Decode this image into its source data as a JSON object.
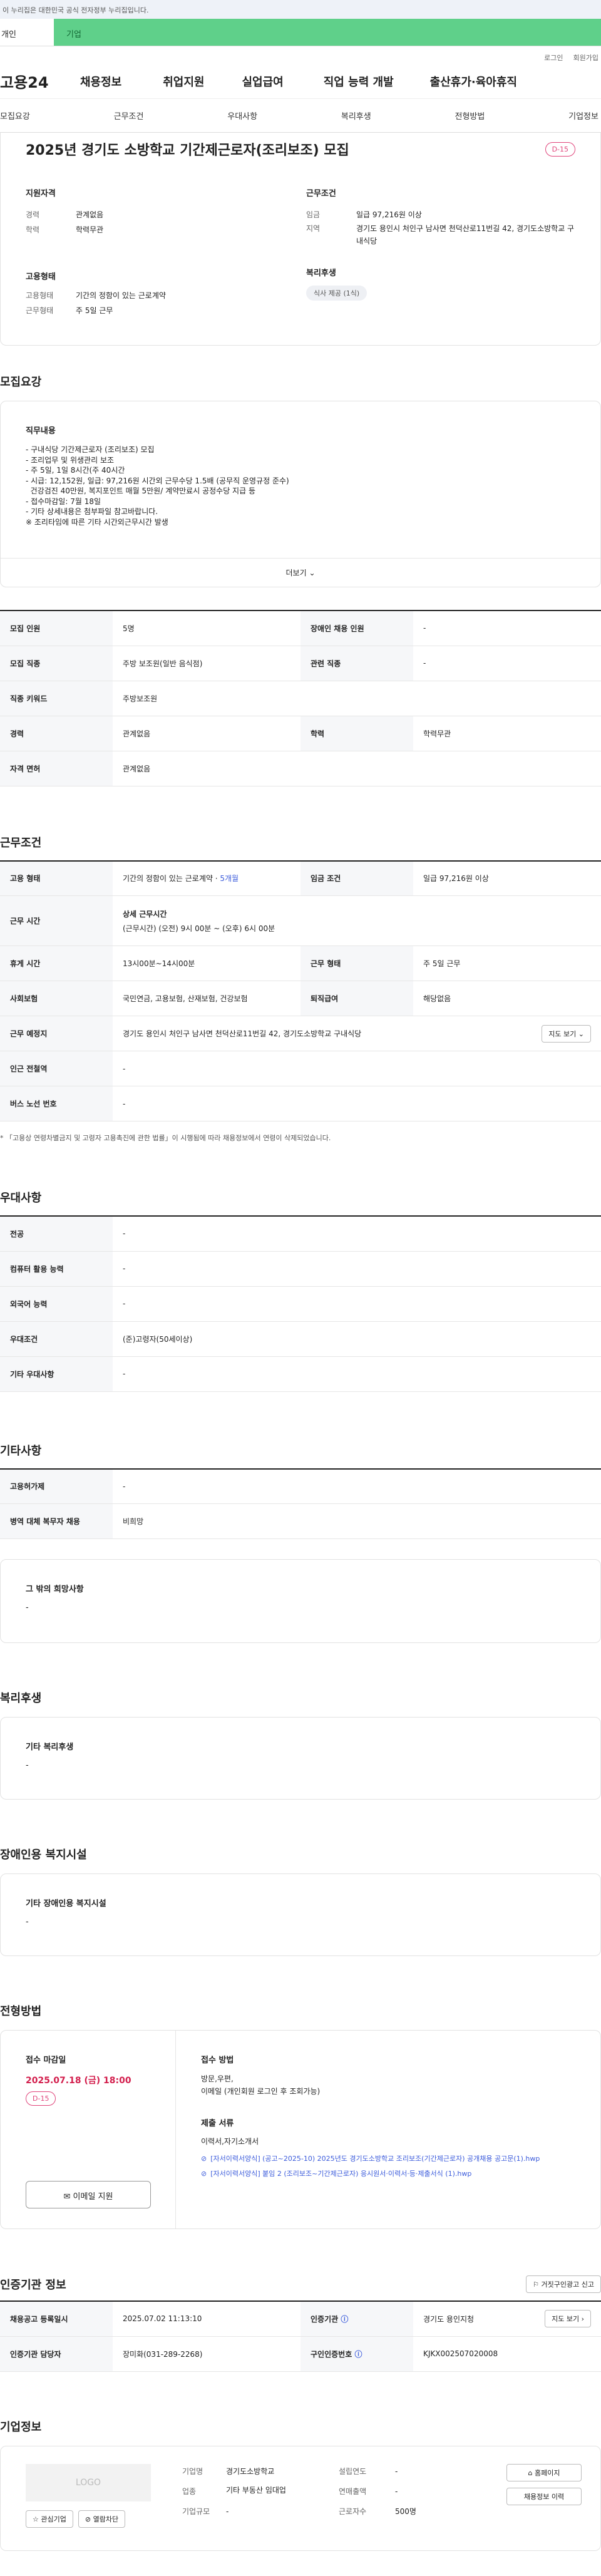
{
  "gov_notice": "이 누리집은 대한민국 공식 전자정부 누리집입니다.",
  "tabs": [
    "개인",
    "기업"
  ],
  "top_links": [
    "로그인",
    "회원가입"
  ],
  "gnb": {
    "logo": "고용24",
    "menu": [
      "채용정보",
      "취업지원",
      "실업급여",
      "직업 능력 개발",
      "출산휴가·육아휴직"
    ]
  },
  "subnav": [
    "모집요강",
    "근무조건",
    "우대사항",
    "복리후생",
    "전형방법",
    "기업정보"
  ],
  "header": {
    "title": "2025년 경기도 소방학교 기간제근로자(조리보조) 모집",
    "dday": "D-15",
    "qual_label": "지원자격",
    "career_k": "경력",
    "career_v": "관계없음",
    "edu_k": "학력",
    "edu_v": "학력무관",
    "cond_label": "근무조건",
    "wage_k": "임금",
    "wage_v": "일급 97,216원 이상",
    "region_k": "지역",
    "region_v": "경기도 용인시 처인구 남사면 천덕산로11번길 42, 경기도소방학교 구내식당",
    "emp_label": "고용형태",
    "etype_k": "고용형태",
    "etype_v": "기간의 정함이 있는 근로계약",
    "eform_k": "근무형태",
    "eform_v": "주 5일 근무",
    "welfare_label": "복리후생",
    "welfare_pill": "식사 제공 (1식)"
  },
  "recruit": {
    "title": "모집요강",
    "duty_label": "직무내용",
    "lines": [
      "- 구내식당 기간제근로자 (조리보조) 모집",
      "- 조리업무 및 위생관리 보조",
      "- 주 5일, 1일 8시간(주 40시간",
      "- 시급: 12,152원, 일급: 97,216원 시간외 근무수당 1.5배 (공무직 운영규정 준수)",
      "  건강검진 40만원, 복지포인트 매월 5만원/ 계약만료시 공정수당 지급 등",
      "- 접수마감일: 7월 18일",
      "- 기타 상세내용은 첨부파일 참고바랍니다.",
      "※ 조리타임에 따른 기타 시간외근무시간 발생"
    ],
    "more": "더보기",
    "rows": [
      [
        "모집 인원",
        "5명",
        "장애인 채용 인원",
        "-"
      ],
      [
        "모집 직종",
        "주방 보조원(일반 음식점)",
        "관련 직종",
        "-"
      ],
      [
        "직종 키워드",
        "주방보조원"
      ],
      [
        "경력",
        "관계없음",
        "학력",
        "학력무관"
      ],
      [
        "자격 면허",
        "관계없음"
      ]
    ]
  },
  "work": {
    "title": "근무조건",
    "etype_k": "고용 형태",
    "etype_v": "기간의 정함이 있는 근로계약 · ",
    "months": "5개월",
    "wage_k": "임금 조건",
    "wage_v": "일급 97,216원 이상",
    "hours_k": "근무 시간",
    "hours_t": "상세 근무시간",
    "hours_v": "(근무시간) (오전) 9시 00분 ~ (오후) 6시 00분",
    "rest_k": "휴게 시간",
    "rest_v": "13시00분~14시00분",
    "form_k": "근무 형태",
    "form_v": "주 5일 근무",
    "ins_k": "사회보험",
    "ins_v": "국민연금, 고용보험, 산재보험, 건강보험",
    "ret_k": "퇴직급여",
    "ret_v": "해당없음",
    "place_k": "근무 예정지",
    "place_v": "경기도 용인시 처인구 남사면 천덕산로11번길 42, 경기도소방학교 구내식당",
    "map": "지도 보기",
    "sub_k": "인근 전철역",
    "sub_v": "-",
    "bus_k": "버스 노선 번호",
    "bus_v": "-",
    "note": "* 「고용상 연령차별금지 및 고령자 고용촉진에 관한 법률」이 시행됨에 따라 채용정보에서 연령이 삭제되었습니다."
  },
  "pref": {
    "title": "우대사항",
    "rows": [
      [
        "전공",
        "-"
      ],
      [
        "컴퓨터 활용 능력",
        "-"
      ],
      [
        "외국어 능력",
        "-"
      ],
      [
        "우대조건",
        "(준)고령자(50세이상)"
      ],
      [
        "기타 우대사항",
        "-"
      ]
    ]
  },
  "etc": {
    "title": "기타사항",
    "rows": [
      [
        "고용허가제",
        "-"
      ],
      [
        "병역 대체 복무자 채용",
        "비희망"
      ]
    ],
    "other_label": "그 밖의 희망사항",
    "other_v": "-"
  },
  "welfare": {
    "title": "복리후생",
    "label": "기타 복리후생",
    "v": "-"
  },
  "disab": {
    "title": "장애인용 복지시설",
    "label": "기타 장애인용 복지시설",
    "v": "-"
  },
  "proc": {
    "title": "전형방법",
    "deadline_label": "접수 마감일",
    "deadline": "2025.07.18 (금) 18:00",
    "dday": "D-15",
    "apply": "이메일 지원",
    "method_label": "접수 방법",
    "method_v": "방문,우편,",
    "method_v2": "이메일 (개인회원 로그인 후 조회가능)",
    "docs_label": "제출 서류",
    "docs_v": "이력서,자기소개서",
    "file1": "[자서이력서양식] (공고~2025-10) 2025년도 경기도소방학교 조리보조(기간제근로자) 공개채용 공고문(1).hwp",
    "file2": "[자서이력서양식] 붙임 2 (조리보조~기간제근로자) 응시원서·이력서·등·제출서식 (1).hwp"
  },
  "agency": {
    "title": "인증기관 정보",
    "report": "거짓구인광고 신고",
    "reg_k": "채용공고 등록일시",
    "reg_v": "2025.07.02 11:13:10",
    "org_k": "인증기관",
    "org_v": "경기도 용인지청",
    "map": "지도 보기",
    "mgr_k": "인증기관 담당자",
    "mgr_v": "장미화(031-289-2268)",
    "no_k": "구인인증번호",
    "no_v": "KJKX002507020008"
  },
  "company": {
    "title": "기업정보",
    "logo": "LOGO",
    "fav": "관심기업",
    "block": "열람차단",
    "name_k": "기업명",
    "name_v": "경기도소방학교",
    "year_k": "설립연도",
    "year_v": "-",
    "ind_k": "업종",
    "ind_v": "기타 부동산 임대업",
    "sales_k": "연매출액",
    "sales_v": "-",
    "emp_k": "근로자수",
    "emp_v": "500명",
    "size_k": "기업규모",
    "size_v": "-",
    "home": "홈페이지",
    "history": "채용정보 이력"
  }
}
